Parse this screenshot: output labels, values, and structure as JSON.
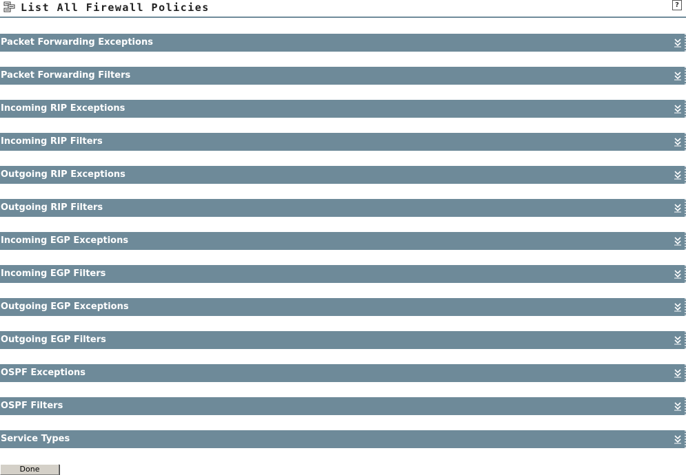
{
  "header": {
    "title": "List All Firewall Policies",
    "icon": "policy-list-icon",
    "help_label": "?"
  },
  "sections": [
    {
      "label": "Packet Forwarding Exceptions",
      "icon": "expand-chevron-icon"
    },
    {
      "label": "Packet Forwarding Filters",
      "icon": "expand-chevron-icon"
    },
    {
      "label": "Incoming RIP Exceptions",
      "icon": "expand-chevron-icon"
    },
    {
      "label": "Incoming RIP Filters",
      "icon": "expand-chevron-icon"
    },
    {
      "label": "Outgoing RIP Exceptions",
      "icon": "expand-chevron-icon"
    },
    {
      "label": "Outgoing RIP Filters",
      "icon": "expand-chevron-icon"
    },
    {
      "label": "Incoming EGP Exceptions",
      "icon": "expand-chevron-icon"
    },
    {
      "label": "Incoming EGP Filters",
      "icon": "expand-chevron-icon"
    },
    {
      "label": "Outgoing EGP Exceptions",
      "icon": "expand-chevron-icon"
    },
    {
      "label": "Outgoing EGP Filters",
      "icon": "expand-chevron-icon"
    },
    {
      "label": "OSPF Exceptions",
      "icon": "expand-chevron-icon"
    },
    {
      "label": "OSPF Filters",
      "icon": "expand-chevron-icon"
    },
    {
      "label": "Service Types",
      "icon": "expand-chevron-icon"
    }
  ],
  "footer": {
    "done_label": "Done"
  },
  "colors": {
    "section_bar": "#6e8a99",
    "section_text": "#ffffff",
    "header_rule": "#6f8b9a",
    "button_face": "#d4d0c8"
  }
}
